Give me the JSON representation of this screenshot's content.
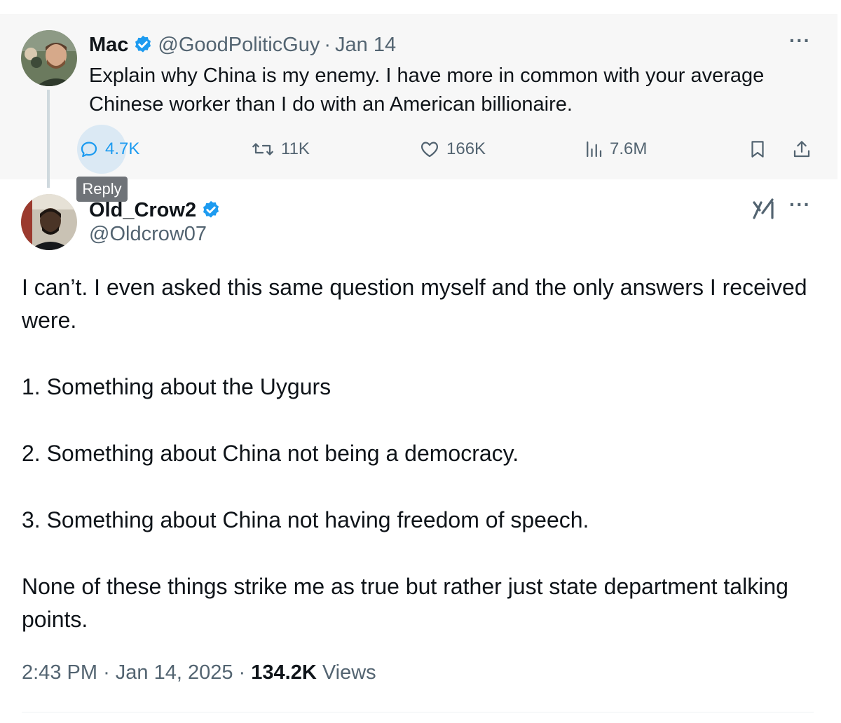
{
  "parent_tweet": {
    "author_name": "Mac",
    "handle": "@GoodPoliticGuy",
    "date": "Jan 14",
    "text": "Explain why China is my enemy. I have more in common with your average Chinese worker than I do with an American billionaire.",
    "stats": {
      "replies": "4.7K",
      "retweets": "11K",
      "likes": "166K",
      "views": "7.6M"
    }
  },
  "tooltip": {
    "label": "Reply"
  },
  "reply_tweet": {
    "author_name": "Old_Crow2",
    "handle": "@Oldcrow07",
    "paragraphs": [
      "I can’t. I even asked this same question myself and the only answers I received were.",
      "1. Something about the Uygurs",
      "2. Something about China not being a democracy.",
      "3. Something about China not having freedom of speech.",
      "None of these things strike me as true but rather just state department talking points."
    ],
    "time": "2:43 PM",
    "date": "Jan 14, 2025",
    "views_count": "134.2K",
    "views_label": "Views"
  },
  "colors": {
    "accent": "#1d9bf0",
    "muted": "#536471",
    "text": "#0f1419",
    "parent_bg": "#f7f7f7"
  },
  "icons": {
    "verified": "verified-badge-icon",
    "reply": "speech-bubble-icon",
    "retweet": "retweet-arrows-icon",
    "like": "heart-icon",
    "views": "bar-chart-icon",
    "bookmark": "bookmark-icon",
    "share": "upload-share-icon",
    "more": "ellipsis-icon",
    "grok": "grok-icon"
  }
}
